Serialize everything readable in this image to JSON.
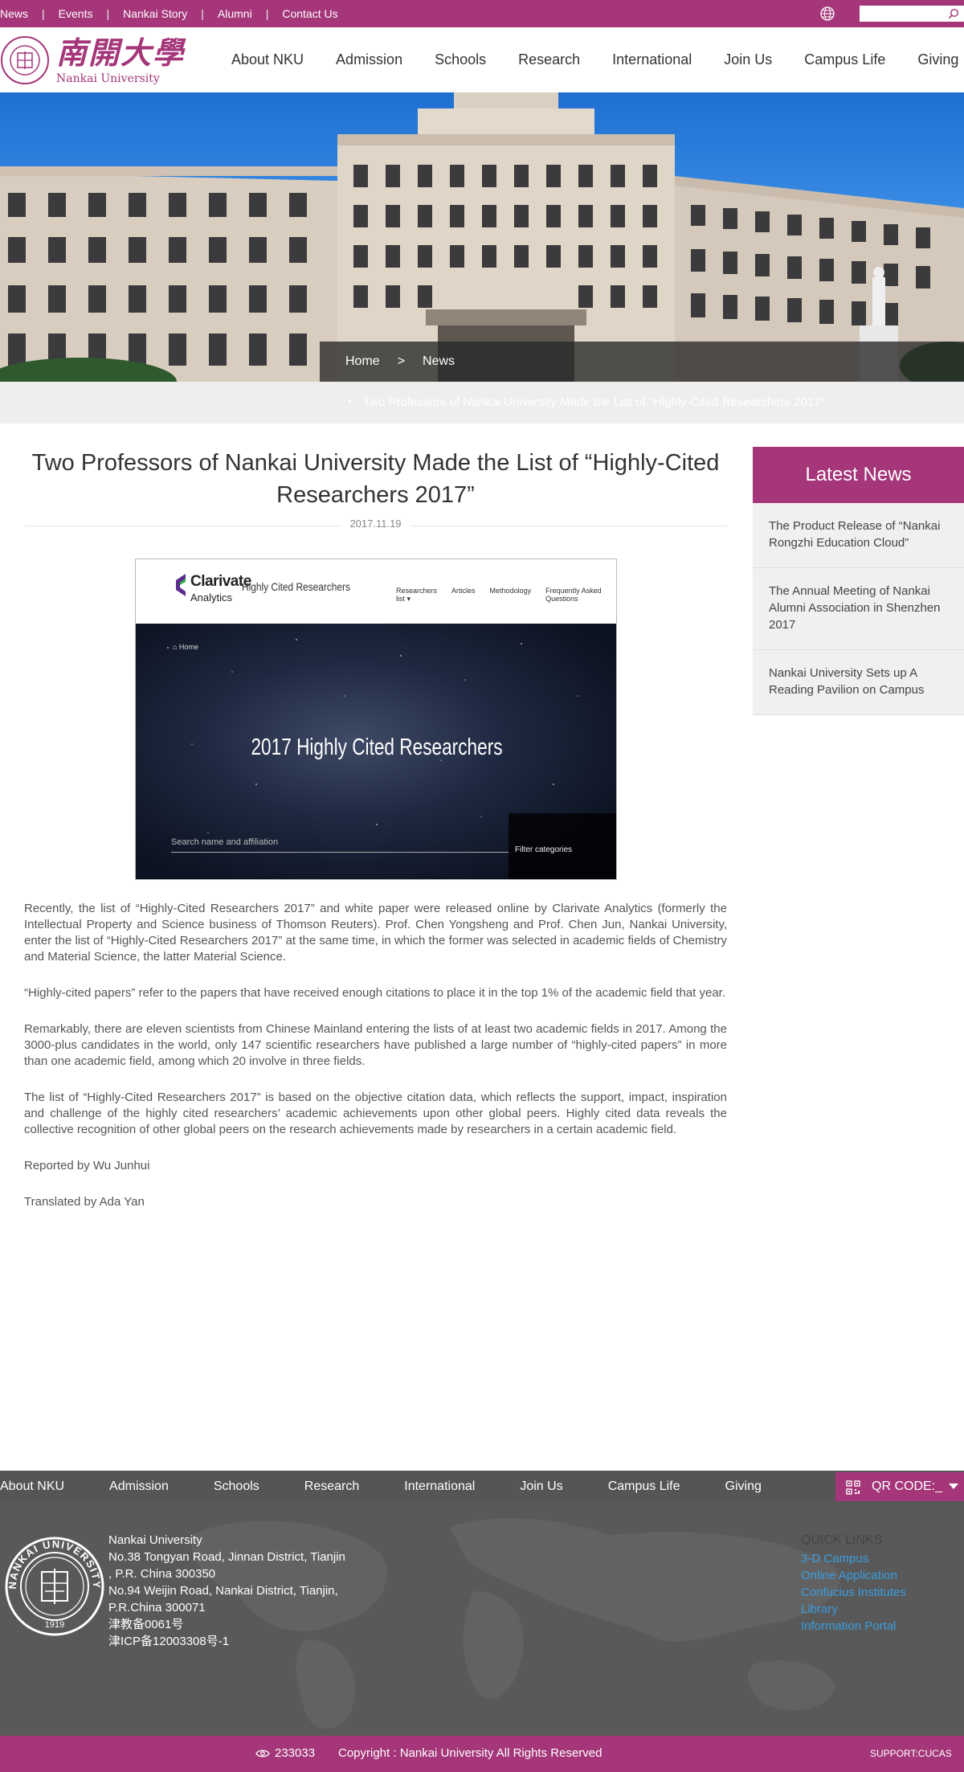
{
  "topbar": {
    "links": [
      "News",
      "Events",
      "Nankai Story",
      "Alumni",
      "Contact Us"
    ],
    "search_placeholder": ""
  },
  "header": {
    "logo_cn": "南開大學",
    "logo_en": "Nankai University",
    "nav": [
      "About NKU",
      "Admission",
      "Schools",
      "Research",
      "International",
      "Join Us",
      "Campus Life",
      "Giving"
    ]
  },
  "breadcrumb": {
    "home": "Home",
    "separator": ">",
    "current": "News",
    "sub": "Two Professors of Nankai University Made the List of “Highly-Cited Researchers 2017”"
  },
  "article": {
    "title": "Two Professors of Nankai University Made the List of “Highly-Cited Researchers 2017”",
    "date": "2017.11.19",
    "figure": {
      "logo": "Clarivate",
      "logo_sub": "Analytics",
      "site_name": "Highly Cited Researchers",
      "menu": [
        "Researchers list ▾",
        "Articles",
        "Methodology",
        "Frequently Asked Questions"
      ],
      "home": "⌂ Home",
      "headline": "2017 Highly Cited Researchers",
      "search": "Search name and affiliation",
      "filter": "Filter categories"
    },
    "paragraphs": [
      "Recently, the list of “Highly-Cited Researchers 2017” and white paper were released online by Clarivate Analytics (formerly the Intellectual Property and Science business of Thomson Reuters). Prof. Chen Yongsheng and Prof. Chen Jun, Nankai University, enter the list of  “Highly-Cited Researchers 2017” at the same time, in which the former was selected in academic fields of Chemistry and Material Science, the latter Material Science.",
      "“Highly-cited papers” refer to the papers that have received enough citations to place it in the top 1% of the academic field that year.",
      "Remarkably, there are eleven scientists from Chinese Mainland entering the lists of at least two academic fields in 2017. Among the 3000-plus candidates in the world, only 147 scientific researchers have published a large number of “highly-cited papers” in more than one academic field, among which 20 involve in three fields.",
      "The list of “Highly-Cited Researchers 2017” is based on the objective citation data, which reflects the support, impact, inspiration and challenge of the highly cited researchers’ academic achievements upon other global peers. Highly cited data reveals the collective recognition of other global peers on the research achievements made by researchers in a certain academic field.",
      "Reported by Wu Junhui",
      "Translated by Ada Yan"
    ]
  },
  "sidebar": {
    "title": "Latest News",
    "items": [
      "The Product Release of “Nankai Rongzhi Education Cloud”",
      "The Annual Meeting of Nankai Alumni Association in Shenzhen 2017",
      "Nankai University Sets up A Reading Pavilion on Campus"
    ]
  },
  "footer": {
    "nav": [
      "About NKU",
      "Admission",
      "Schools",
      "Research",
      "International",
      "Join Us",
      "Campus Life",
      "Giving"
    ],
    "qr_label": "QR CODE:_",
    "seal_text": "NANKAI UNIVERSITY",
    "seal_year": "1919",
    "address": [
      "Nankai University",
      "No.38 Tongyan Road, Jinnan District, Tianjin",
      ", P.R. China 300350",
      "No.94 Weijin Road,  Nankai District, Tianjin,",
      "P.R.China  300071",
      "津教备0061号",
      "津ICP备12003308号-1"
    ],
    "quick_links_title": "QUICK LINKS",
    "quick_links": [
      "3-D Campus",
      "Online Application",
      "Confucius Institutes",
      "Library",
      "Information Portal"
    ],
    "visits": "233033",
    "copyright": "Copyright : Nankai University All Rights Reserved",
    "support": "SUPPORT:CUCAS"
  },
  "colors": {
    "brand": "#a43679",
    "link": "#3a9de0",
    "footer_bg": "#595959"
  }
}
